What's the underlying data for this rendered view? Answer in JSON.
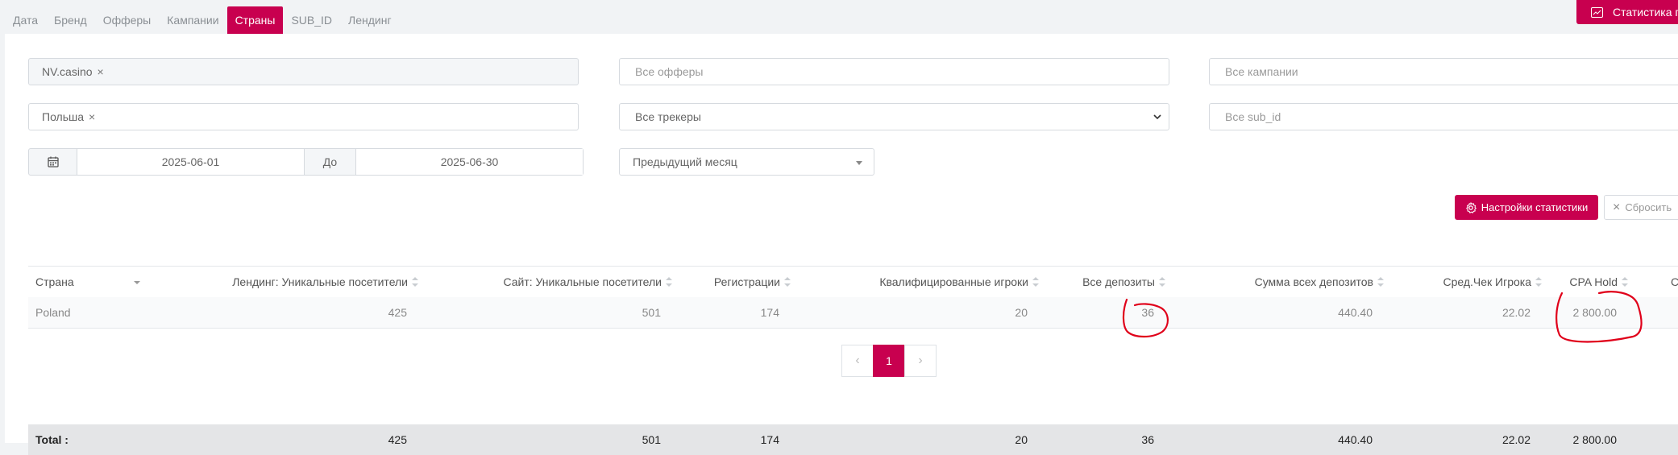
{
  "tabs": [
    "Дата",
    "Бренд",
    "Офферы",
    "Кампании",
    "Страны",
    "SUB_ID",
    "Лендинг"
  ],
  "active_tab": "Страны",
  "header_button": "Статистика п",
  "filters": {
    "brand_tag": "NV.casino",
    "offers_placeholder": "Все офферы",
    "campaigns_placeholder": "Все кампании",
    "country_tag": "Польша",
    "trackers_selected": "Все трекеры",
    "subid_placeholder": "Все sub_id",
    "date_from": "2025-06-01",
    "date_to_label": "До",
    "date_to": "2025-06-30",
    "period": "Предыдущий месяц"
  },
  "buttons": {
    "settings": "Настройки статистики",
    "reset": "Сбросить"
  },
  "table": {
    "columns": [
      "Страна",
      "Лендинг: Уникальные посетители",
      "Сайт: Уникальные посетители",
      "Регистрации",
      "Квалифицированные игроки",
      "Все депозиты",
      "Сумма всех депозитов",
      "Сред.Чек Игрока",
      "CPA Hold",
      "С"
    ],
    "rows": [
      [
        "Poland",
        "425",
        "501",
        "174",
        "20",
        "36",
        "440.40",
        "22.02",
        "2 800.00"
      ]
    ],
    "total": [
      "Total :",
      "425",
      "501",
      "174",
      "20",
      "36",
      "440.40",
      "22.02",
      "2 800.00"
    ]
  },
  "pagination": {
    "prev": "‹",
    "current": "1",
    "next": "›"
  },
  "colors": {
    "accent": "#c8004f",
    "annotation": "#e0001a"
  }
}
